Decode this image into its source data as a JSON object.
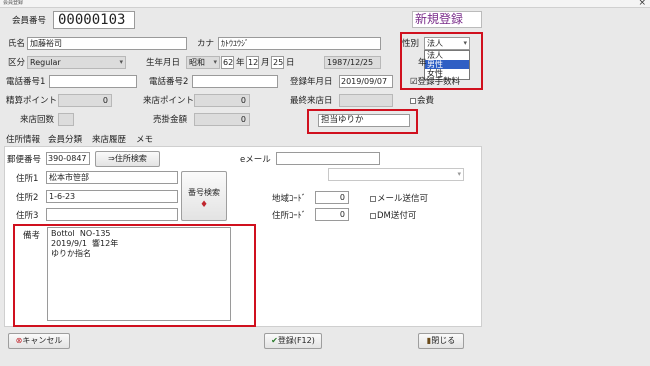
{
  "window": {
    "title": "会員登録"
  },
  "header": {
    "member_no_label": "会員番号",
    "member_no": "00000103",
    "mode_label": "新規登録"
  },
  "row_name": {
    "name_label": "氏名",
    "name_value": "加藤裕司",
    "kana_label": "カナ",
    "kana_value": "ｶﾄｳﾕｳｼﾞ",
    "gender_label": "性別",
    "gender_value": "法人",
    "gender_options": [
      "法人",
      "男性",
      "女性"
    ],
    "gender_highlighted": "男性"
  },
  "row_class": {
    "class_label": "区分",
    "class_value": "Regular",
    "birth_label": "生年月日",
    "era_value": "昭和",
    "year_value": "62",
    "year_unit": "年",
    "month_value": "12",
    "month_unit": "月",
    "day_value": "25",
    "day_unit": "日",
    "birth_date": "1987/12/25",
    "age_label_partial": "年"
  },
  "row_phone": {
    "phone1_label": "電話番号1",
    "phone1_value": "",
    "phone2_label": "電話番号2",
    "phone2_value": "",
    "reg_date_label": "登録年月日",
    "reg_date_value": "2019/09/07",
    "reg_fee_label": "☑登録手数料"
  },
  "row_points": {
    "settle_points_label": "精算ポイント",
    "settle_points_value": "0",
    "visit_points_label": "来店ポイント",
    "visit_points_value": "0",
    "last_visit_label": "最終来店日",
    "last_visit_value": "",
    "fee_label": "会費"
  },
  "row_visits": {
    "visit_count_label": "来店回数",
    "visit_count_value": "",
    "credit_label": "売掛金額",
    "credit_value": "0",
    "staff_label": "担当",
    "staff_value": "ゆりか"
  },
  "tabs": [
    "住所情報",
    "会員分類",
    "来店履歴",
    "メモ"
  ],
  "address": {
    "zip_label": "郵便番号",
    "zip_value": "390-0847",
    "address_search_button": "住所検索",
    "email_label": "eメール",
    "email_value": "",
    "addr1_label": "住所1",
    "addr1_value": "松本市笹部",
    "addr2_label": "住所2",
    "addr2_value": "1-6-23",
    "addr3_label": "住所3",
    "addr3_value": "",
    "number_search_button": "番号検索",
    "area_code_label": "地域ｺｰﾄﾞ",
    "area_code_value": "0",
    "addr_code_label": "住所ｺｰﾄﾞ",
    "addr_code_value": "0",
    "mail_ok_label": "メール送信可",
    "dm_ok_label": "DM送付可",
    "note_label": "備考",
    "note_lines": [
      "Bottol  NO-135",
      "2019/9/1  響12年",
      "ゆりか指名"
    ]
  },
  "footer": {
    "cancel_button": "キャンセル",
    "register_button": "登録(F12)",
    "close_button": "閉じる"
  },
  "colors": {
    "highlight": "#d0101e",
    "mode_text": "#7a2c8a",
    "dropdown_select": "#2f5fc4"
  }
}
